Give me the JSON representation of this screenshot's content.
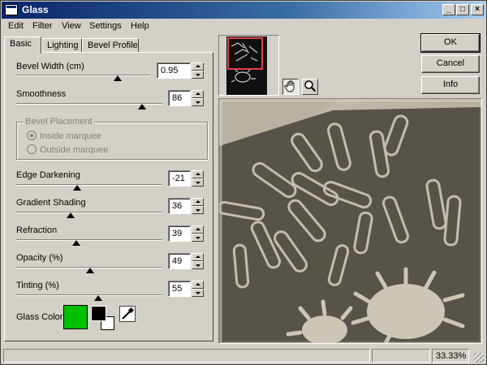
{
  "window": {
    "title": "Glass"
  },
  "menu": [
    "Edit",
    "Filter",
    "View",
    "Settings",
    "Help"
  ],
  "tabs": [
    {
      "label": "Basic",
      "active": true
    },
    {
      "label": "Lighting",
      "active": false
    },
    {
      "label": "Bevel Profile",
      "active": false
    }
  ],
  "controls": {
    "bevel_width": {
      "label": "Bevel Width (cm)",
      "value": "0.95",
      "level": 0.71
    },
    "smoothness": {
      "label": "Smoothness",
      "value": "86",
      "level": 0.86
    },
    "bevel_placement": {
      "legend": "Bevel Placement",
      "options": [
        "Inside marquee",
        "Outside marquee"
      ],
      "selected": "Inside marquee"
    },
    "edge_darkening": {
      "label": "Edge Darkening",
      "value": "-21",
      "level": 0.39
    },
    "gradient_shading": {
      "label": "Gradient Shading",
      "value": "36",
      "level": 0.36
    },
    "refraction": {
      "label": "Refraction",
      "value": "39",
      "level": 0.39
    },
    "opacity": {
      "label": "Opacity (%)",
      "value": "49",
      "level": 0.49
    },
    "tinting": {
      "label": "Tinting (%)",
      "value": "55",
      "level": 0.55
    },
    "glass_color": {
      "label": "Glass Color",
      "color": "#00c000"
    }
  },
  "buttons": {
    "ok": "OK",
    "cancel": "Cancel",
    "info": "Info"
  },
  "tools": [
    "hand-icon",
    "zoom-icon"
  ],
  "status": {
    "zoom": "33.33%"
  },
  "colors": {
    "title_start": "#0a246a",
    "title_end": "#a6caf0",
    "face": "#d4d0c8",
    "glass": "#00c000"
  }
}
